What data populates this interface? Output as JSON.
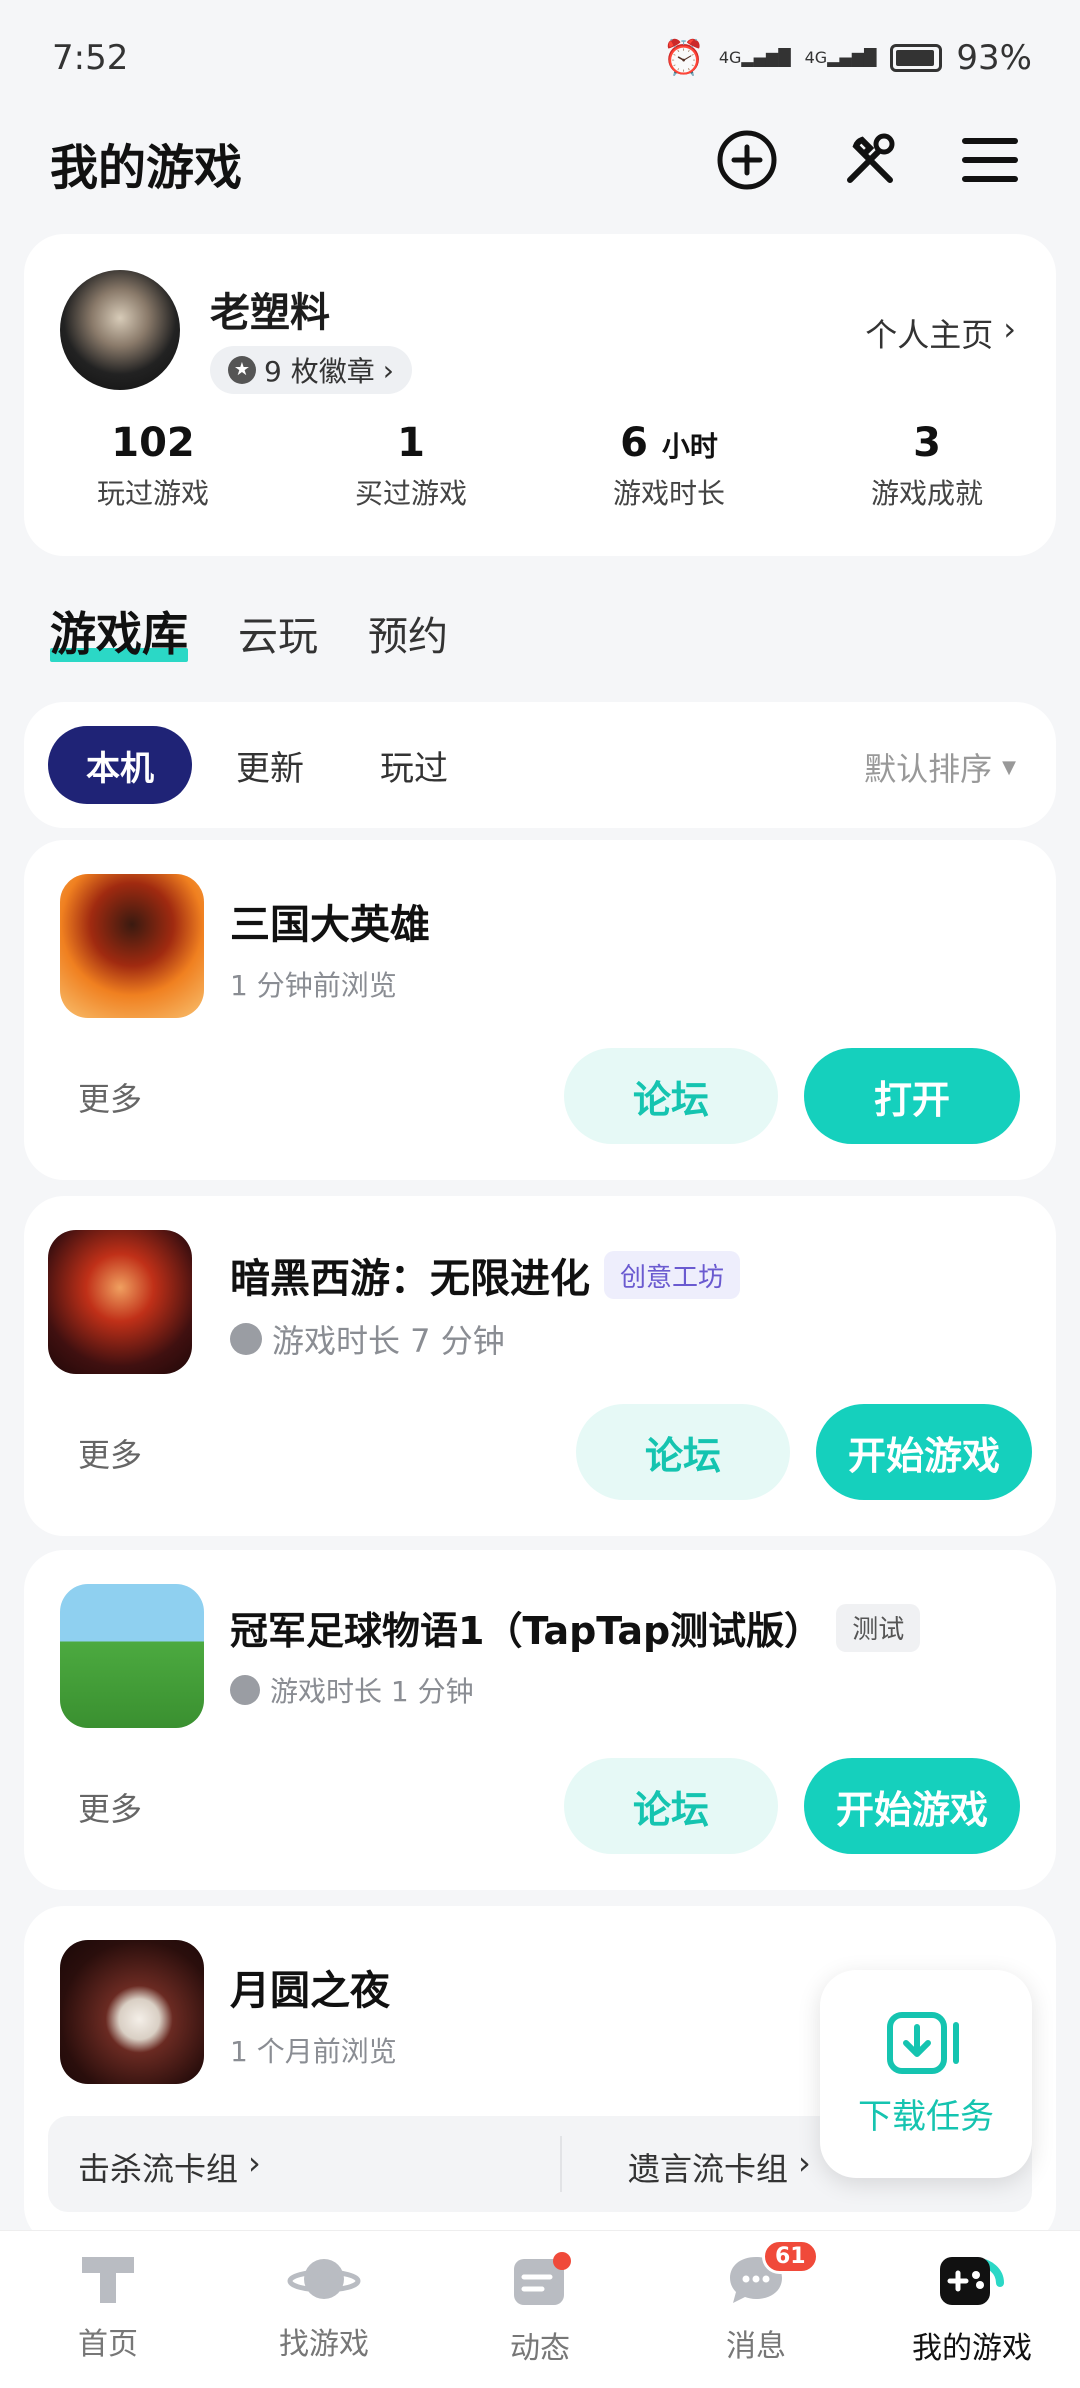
{
  "status_bar": {
    "time": "7:52",
    "battery": "93%",
    "signal1": "4G",
    "signal2": "4G"
  },
  "header": {
    "title": "我的游戏",
    "add_icon": "plus-circle-icon",
    "tools_icon": "tools-icon",
    "menu_icon": "menu-icon"
  },
  "profile": {
    "name": "老塑料",
    "badges": "9 枚徽章",
    "home_link": "个人主页",
    "stats": [
      {
        "num": "102",
        "unit": "",
        "label": "玩过游戏"
      },
      {
        "num": "1",
        "unit": "",
        "label": "买过游戏"
      },
      {
        "num": "6",
        "unit": "小时",
        "label": "游戏时长"
      },
      {
        "num": "3",
        "unit": "",
        "label": "游戏成就"
      }
    ]
  },
  "tabs": [
    "游戏库",
    "云玩",
    "预约"
  ],
  "filters": {
    "chips": [
      "本机",
      "更新",
      "玩过"
    ],
    "sort": "默认排序"
  },
  "games": [
    {
      "name": "三国大英雄",
      "sub": "1 分钟前浏览",
      "tag": "",
      "more": "更多",
      "forum": "论坛",
      "action": "打开"
    },
    {
      "name": "暗黑西游：无限进化",
      "sub": "游戏时长 7 分钟",
      "tag": "创意工坊",
      "more": "更多",
      "forum": "论坛",
      "action": "开始游戏"
    },
    {
      "name": "冠军足球物语1（TapTap测试版）",
      "sub": "游戏时长 1 分钟",
      "tag": "测试",
      "more": "更多",
      "forum": "论坛",
      "action": "开始游戏"
    },
    {
      "name": "月圆之夜",
      "sub": "1 个月前浏览",
      "deck1": "击杀流卡组",
      "deck2": "遗言流卡组"
    }
  ],
  "float_button": {
    "label": "下载任务"
  },
  "bottom_nav": [
    {
      "label": "首页",
      "icon": "home-icon"
    },
    {
      "label": "找游戏",
      "icon": "planet-icon"
    },
    {
      "label": "动态",
      "icon": "feed-icon"
    },
    {
      "label": "消息",
      "icon": "message-icon",
      "badge": "61"
    },
    {
      "label": "我的游戏",
      "icon": "gamepad-icon"
    }
  ],
  "colors": {
    "accent": "#15d0bd",
    "chip_active": "#1f2376",
    "background": "#f5f6f8"
  }
}
